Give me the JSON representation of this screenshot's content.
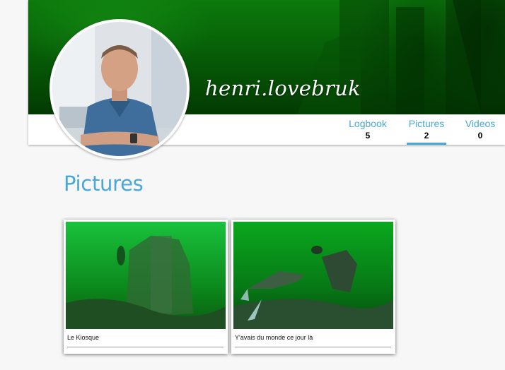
{
  "profile": {
    "username": "henri.lovebruk"
  },
  "tabs": [
    {
      "label": "Logbook",
      "count": "5"
    },
    {
      "label": "Pictures",
      "count": "2",
      "active": true
    },
    {
      "label": "Videos",
      "count": "0"
    }
  ],
  "section": {
    "title": "Pictures"
  },
  "pictures": [
    {
      "caption": "Le Kiosque"
    },
    {
      "caption": "Y'avais du monde ce jour là"
    }
  ],
  "colors": {
    "accent": "#4aa8d8",
    "cover_green": "#065806"
  }
}
